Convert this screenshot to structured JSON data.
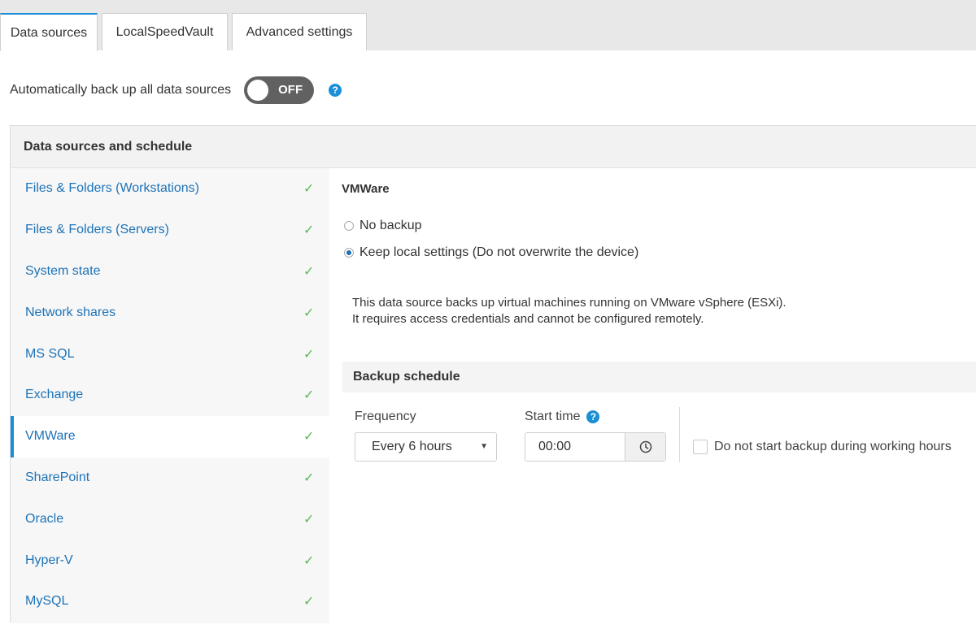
{
  "tabs": [
    {
      "label": "Data sources",
      "active": true
    },
    {
      "label": "LocalSpeedVault",
      "active": false
    },
    {
      "label": "Advanced settings",
      "active": false
    }
  ],
  "auto_backup": {
    "label": "Automatically back up all data sources",
    "toggle_state": "OFF",
    "help_icon": "?"
  },
  "panel": {
    "header": "Data sources and schedule"
  },
  "sidebar": {
    "items": [
      {
        "label": "Files & Folders (Workstations)",
        "check": "✓"
      },
      {
        "label": "Files & Folders (Servers)",
        "check": "✓"
      },
      {
        "label": "System state",
        "check": "✓"
      },
      {
        "label": "Network shares",
        "check": "✓"
      },
      {
        "label": "MS SQL",
        "check": "✓"
      },
      {
        "label": "Exchange",
        "check": "✓"
      },
      {
        "label": "VMWare",
        "check": "✓",
        "active": true
      },
      {
        "label": "SharePoint",
        "check": "✓"
      },
      {
        "label": "Oracle",
        "check": "✓"
      },
      {
        "label": "Hyper-V",
        "check": "✓"
      },
      {
        "label": "MySQL",
        "check": "✓"
      }
    ]
  },
  "detail": {
    "title": "VMWare",
    "options": [
      {
        "label": "No backup",
        "checked": false
      },
      {
        "label": "Keep local settings (Do not overwrite the device)",
        "checked": true
      }
    ],
    "description_line1": "This data source backs up virtual machines running on VMware vSphere (ESXi).",
    "description_line2": "It requires access credentials and cannot be configured remotely.",
    "schedule": {
      "header": "Backup schedule",
      "frequency_label": "Frequency",
      "frequency_value": "Every 6 hours",
      "start_time_label": "Start time",
      "start_time_value": "00:00",
      "working_hours_label": "Do not start backup during working hours",
      "working_hours_checked": false
    }
  },
  "colors": {
    "accent": "#1a8fd6",
    "link": "#1d73b8",
    "check": "#5cb85c",
    "toggle_off": "#616161"
  }
}
